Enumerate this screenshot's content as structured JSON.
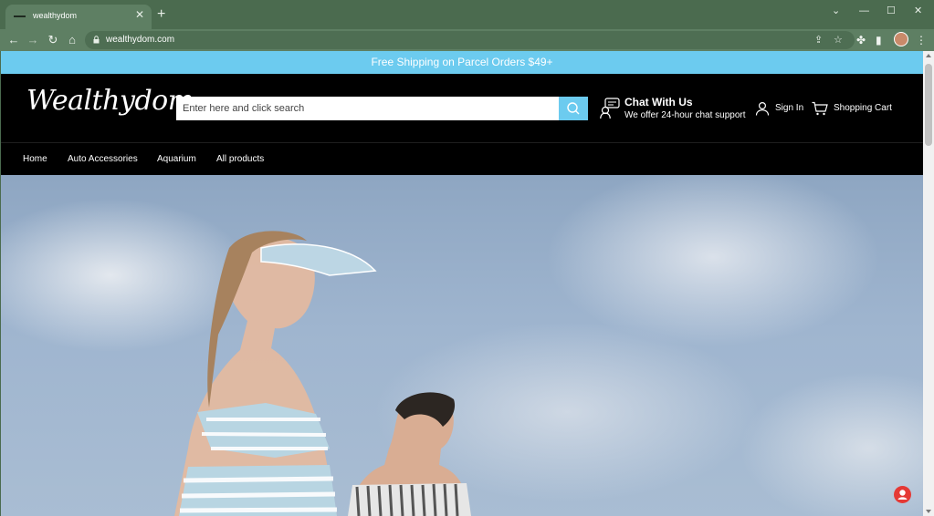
{
  "browser": {
    "tab_title": "wealthydom",
    "url": "wealthydom.com",
    "new_tab_label": "+",
    "close_tab_label": "✕"
  },
  "announcement": "Free Shipping on Parcel Orders $49+",
  "header": {
    "logo_text": "Wealthydom",
    "search_placeholder": "Enter here and click search",
    "chat_title": "Chat With Us",
    "chat_subtitle": "We offer 24-hour chat support",
    "signin_label": "Sign In",
    "cart_label": "Shopping Cart"
  },
  "nav": {
    "items": [
      "Home",
      "Auto Accessories",
      "Aquarium",
      "All products"
    ]
  },
  "colors": {
    "accent": "#6ccbef",
    "chrome_frame": "#4b6b4f",
    "header_bg": "#000000"
  }
}
